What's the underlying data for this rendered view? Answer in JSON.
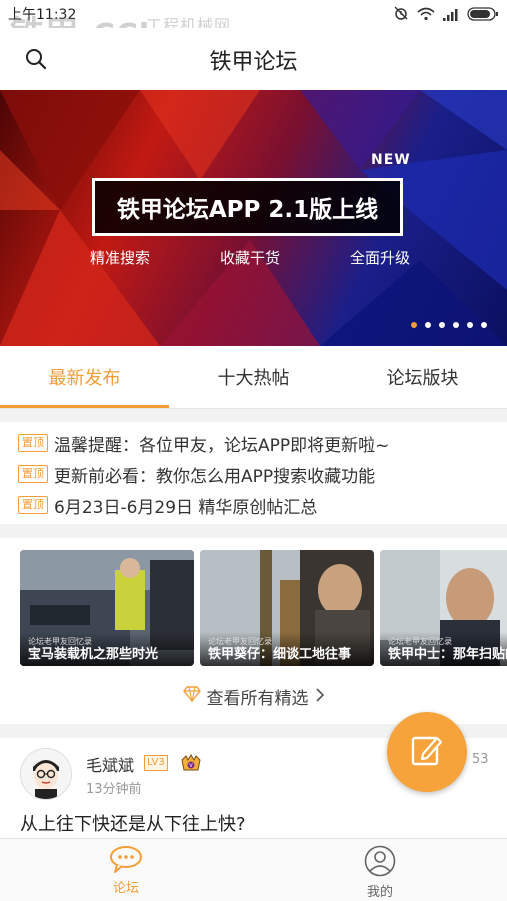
{
  "status": {
    "time": "上午11:32"
  },
  "watermark": {
    "logo": "铁甲",
    "url": "CChome.com",
    "sub": "工程机械网"
  },
  "header": {
    "title": "铁甲论坛"
  },
  "banner": {
    "new_tag": "NEW",
    "headline": "铁甲论坛APP 2.1版上线",
    "tags": [
      "精准搜索",
      "收藏干货",
      "全面升级"
    ],
    "slide_count": 6,
    "active_slide": 1
  },
  "tabs": [
    {
      "label": "最新发布",
      "active": true
    },
    {
      "label": "十大热帖",
      "active": false
    },
    {
      "label": "论坛版块",
      "active": false
    }
  ],
  "pinned": {
    "badge": "置顶",
    "items": [
      "温馨提醒：各位甲友，论坛APP即将更新啦~",
      "更新前必看：教你怎么用APP搜索收藏功能",
      "6月23日-6月29日 精华原创帖汇总"
    ]
  },
  "featured": {
    "cards": [
      {
        "small": "论坛老甲友回忆录",
        "title": "宝马装载机之那些时光"
      },
      {
        "small": "论坛老甲友回忆录",
        "title": "铁甲葵仔：细谈工地往事"
      },
      {
        "small": "论坛老甲友回忆录",
        "title": "铁甲中士：那年扫贴的"
      }
    ],
    "see_all": "查看所有精选"
  },
  "post": {
    "author": "毛斌斌",
    "level": "LV3",
    "time": "13分钟前",
    "count": "53",
    "title": "从上往下快还是从下往上快?"
  },
  "bottom_nav": [
    {
      "label": "论坛",
      "active": true
    },
    {
      "label": "我的",
      "active": false
    }
  ],
  "colors": {
    "accent": "#f29d38",
    "fab": "#f5a33a"
  }
}
